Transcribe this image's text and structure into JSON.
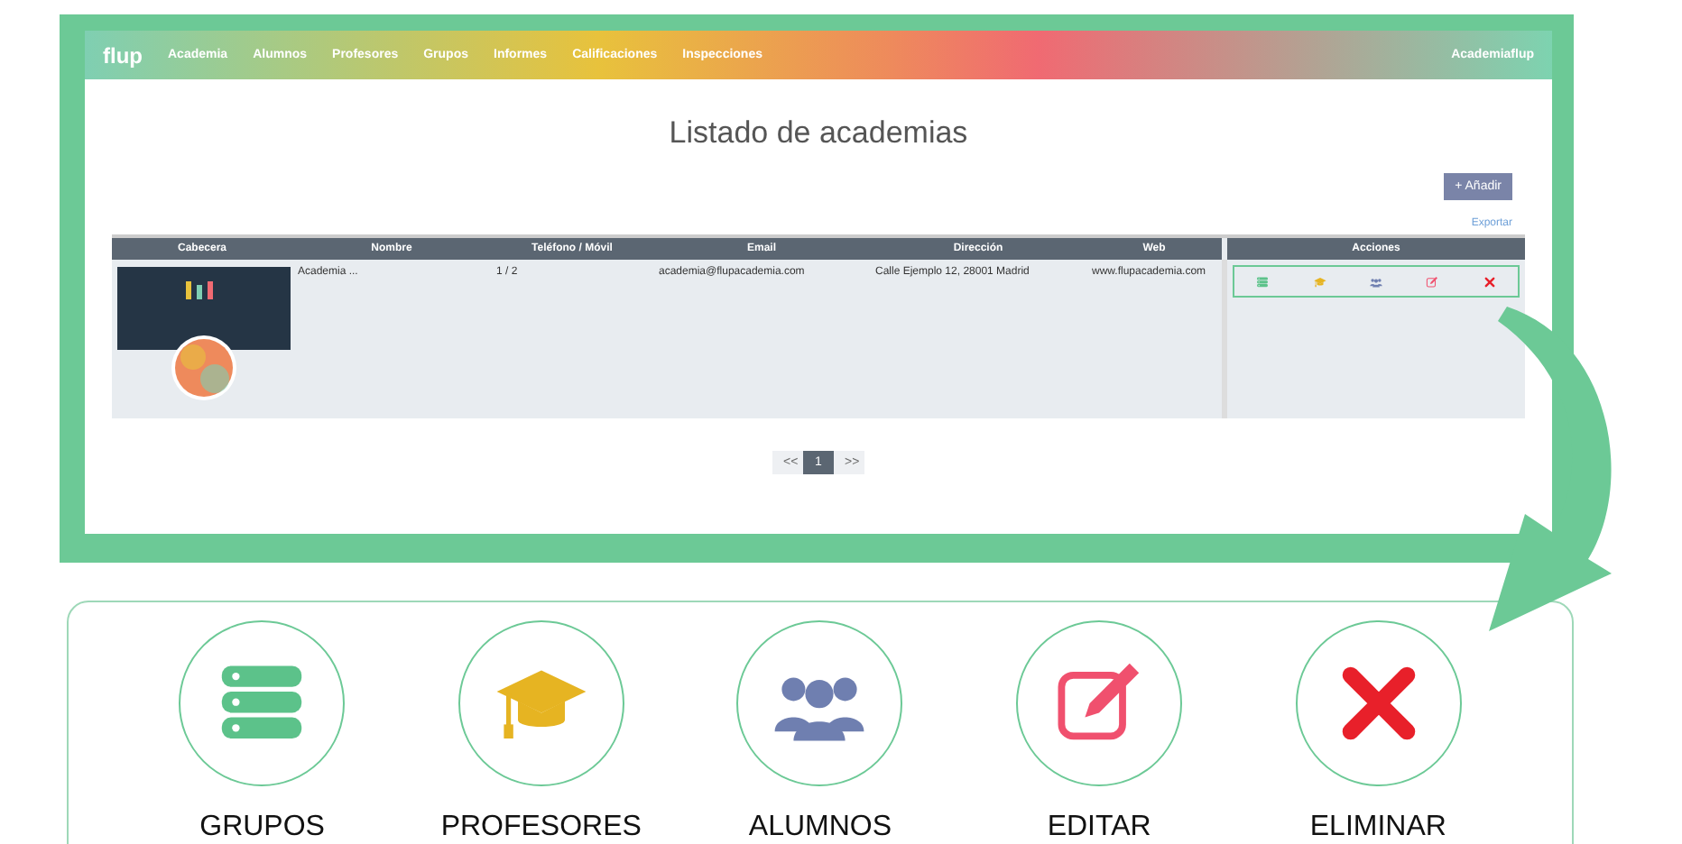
{
  "app": {
    "logo": "flup",
    "nav": [
      "Academia",
      "Alumnos",
      "Profesores",
      "Grupos",
      "Informes",
      "Calificaciones",
      "Inspecciones"
    ],
    "user": "Academiaflup"
  },
  "page": {
    "title": "Listado de academias",
    "add_button": "+ Añadir",
    "export_link": "Exportar"
  },
  "table": {
    "columns": [
      "Cabecera",
      "Nombre",
      "Teléfono / Móvil",
      "Email",
      "Dirección",
      "Web"
    ],
    "actions_column": "Acciones",
    "rows": [
      {
        "name": "Academia ...",
        "phone": "1 / 2",
        "email": "academia@flupacademia.com",
        "address": "Calle Ejemplo 12, 28001 Madrid",
        "web": "www.flupacademia.com"
      }
    ]
  },
  "pagination": [
    {
      "label": "<<",
      "selected": false
    },
    {
      "label": "1",
      "selected": true
    },
    {
      "label": ">>",
      "selected": false
    }
  ],
  "actions": [
    {
      "kind": "groups",
      "label": "GRUPOS",
      "color": "#5cc28a"
    },
    {
      "kind": "teachers",
      "label": "PROFESORES",
      "color": "#e6b422"
    },
    {
      "kind": "students",
      "label": "ALUMNOS",
      "color": "#6f7fb0"
    },
    {
      "kind": "edit",
      "label": "EDITAR",
      "color": "#f0506e"
    },
    {
      "kind": "delete",
      "label": "ELIMINAR",
      "color": "#e8202a"
    }
  ]
}
